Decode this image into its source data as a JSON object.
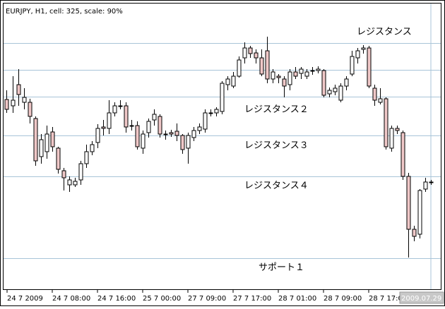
{
  "header": {
    "title": "EURJPY, H1, cell: 325, scale: 90%"
  },
  "watermark": "2009.07.29",
  "colors": {
    "up_candle": "#ffffff",
    "down_candle": "#f0c8c8",
    "candle_outline": "#000000",
    "level_line": "#a8c4d8",
    "frame": "#000000"
  },
  "chart_data": {
    "type": "candlestick",
    "title": "",
    "xlabel": "",
    "ylabel": "",
    "x_tick_labels": [
      "24 7 2009",
      "24 7 08:00",
      "24 7 16:00",
      "25 7 00:00",
      "27 7 09:00",
      "27 7 17:00",
      "28 7 01:00",
      "28 7 09:00",
      "28 7 17:00"
    ],
    "y_levels": [
      {
        "label": "レジスタンス",
        "value": 61
      },
      {
        "label": "",
        "value": 99
      },
      {
        "label": "レジスタンス２",
        "value": 137
      },
      {
        "label": "レジスタンス３",
        "value": 192
      },
      {
        "label": "レジスタンス４",
        "value": 250
      },
      {
        "label": "サポート１",
        "value": 366
      }
    ],
    "grid": false,
    "candles": [
      [
        9,
        141,
        155,
        128,
        160
      ],
      [
        18,
        150,
        142,
        108,
        160
      ],
      [
        26,
        120,
        134,
        98,
        150
      ],
      [
        34,
        145,
        138,
        125,
        155
      ],
      [
        42,
        145,
        165,
        140,
        175
      ],
      [
        50,
        168,
        228,
        165,
        235
      ],
      [
        58,
        222,
        198,
        190,
        232
      ],
      [
        66,
        215,
        190,
        178,
        225
      ],
      [
        74,
        187,
        208,
        180,
        215
      ],
      [
        82,
        210,
        240,
        208,
        246
      ],
      [
        90,
        242,
        252,
        238,
        270
      ],
      [
        98,
        262,
        255,
        250,
        272
      ],
      [
        106,
        262,
        257,
        252,
        265
      ],
      [
        114,
        255,
        232,
        228,
        262
      ],
      [
        122,
        232,
        215,
        205,
        238
      ],
      [
        130,
        215,
        205,
        200,
        220
      ],
      [
        138,
        202,
        182,
        176,
        210
      ],
      [
        146,
        180,
        182,
        170,
        192
      ],
      [
        154,
        182,
        160,
        142,
        190
      ],
      [
        162,
        160,
        150,
        145,
        165
      ],
      [
        170,
        150,
        150,
        142,
        155
      ],
      [
        178,
        150,
        180,
        145,
        188
      ],
      [
        186,
        178,
        178,
        170,
        185
      ],
      [
        194,
        178,
        208,
        172,
        212
      ],
      [
        202,
        210,
        190,
        185,
        218
      ],
      [
        210,
        188,
        172,
        168,
        195
      ],
      [
        218,
        170,
        162,
        155,
        178
      ],
      [
        226,
        165,
        190,
        162,
        195
      ],
      [
        234,
        190,
        190,
        185,
        198
      ],
      [
        242,
        188,
        190,
        184,
        194
      ],
      [
        250,
        186,
        192,
        175,
        200
      ],
      [
        258,
        192,
        212,
        190,
        218
      ],
      [
        266,
        210,
        192,
        188,
        232
      ],
      [
        274,
        195,
        185,
        180,
        200
      ],
      [
        282,
        185,
        180,
        175,
        190
      ],
      [
        290,
        183,
        160,
        155,
        188
      ],
      [
        298,
        160,
        160,
        155,
        165
      ],
      [
        306,
        160,
        155,
        152,
        165
      ],
      [
        314,
        158,
        118,
        115,
        162
      ],
      [
        322,
        120,
        112,
        108,
        128
      ],
      [
        330,
        122,
        108,
        102,
        125
      ],
      [
        338,
        108,
        85,
        80,
        110
      ],
      [
        346,
        82,
        68,
        60,
        90
      ],
      [
        354,
        68,
        76,
        65,
        82
      ],
      [
        362,
        75,
        82,
        70,
        90
      ],
      [
        370,
        82,
        105,
        70,
        108
      ],
      [
        378,
        72,
        112,
        52,
        118
      ],
      [
        386,
        112,
        102,
        98,
        118
      ],
      [
        394,
        108,
        110,
        105,
        118
      ],
      [
        402,
        112,
        122,
        108,
        138
      ],
      [
        410,
        120,
        102,
        98,
        128
      ],
      [
        418,
        102,
        108,
        95,
        112
      ],
      [
        426,
        104,
        98,
        95,
        112
      ],
      [
        434,
        108,
        102,
        98,
        112
      ],
      [
        442,
        100,
        100,
        95,
        106
      ],
      [
        450,
        100,
        98,
        94,
        104
      ],
      [
        458,
        100,
        135,
        98,
        138
      ],
      [
        466,
        133,
        128,
        124,
        138
      ],
      [
        474,
        130,
        125,
        120,
        135
      ],
      [
        482,
        142,
        122,
        118,
        145
      ],
      [
        490,
        122,
        112,
        108,
        128
      ],
      [
        498,
        105,
        80,
        72,
        108
      ],
      [
        506,
        82,
        72,
        68,
        90
      ],
      [
        514,
        70,
        68,
        64,
        76
      ],
      [
        522,
        68,
        122,
        65,
        125
      ],
      [
        530,
        125,
        142,
        120,
        150
      ],
      [
        538,
        145,
        140,
        125,
        148
      ],
      [
        546,
        140,
        208,
        138,
        212
      ],
      [
        554,
        210,
        182,
        178,
        215
      ],
      [
        562,
        182,
        185,
        178,
        190
      ],
      [
        570,
        188,
        250,
        185,
        255
      ],
      [
        578,
        250,
        325,
        245,
        365
      ],
      [
        586,
        325,
        335,
        320,
        342
      ],
      [
        594,
        332,
        270,
        268,
        338
      ],
      [
        602,
        268,
        258,
        252,
        272
      ],
      [
        610,
        258,
        258,
        255,
        262
      ]
    ]
  }
}
